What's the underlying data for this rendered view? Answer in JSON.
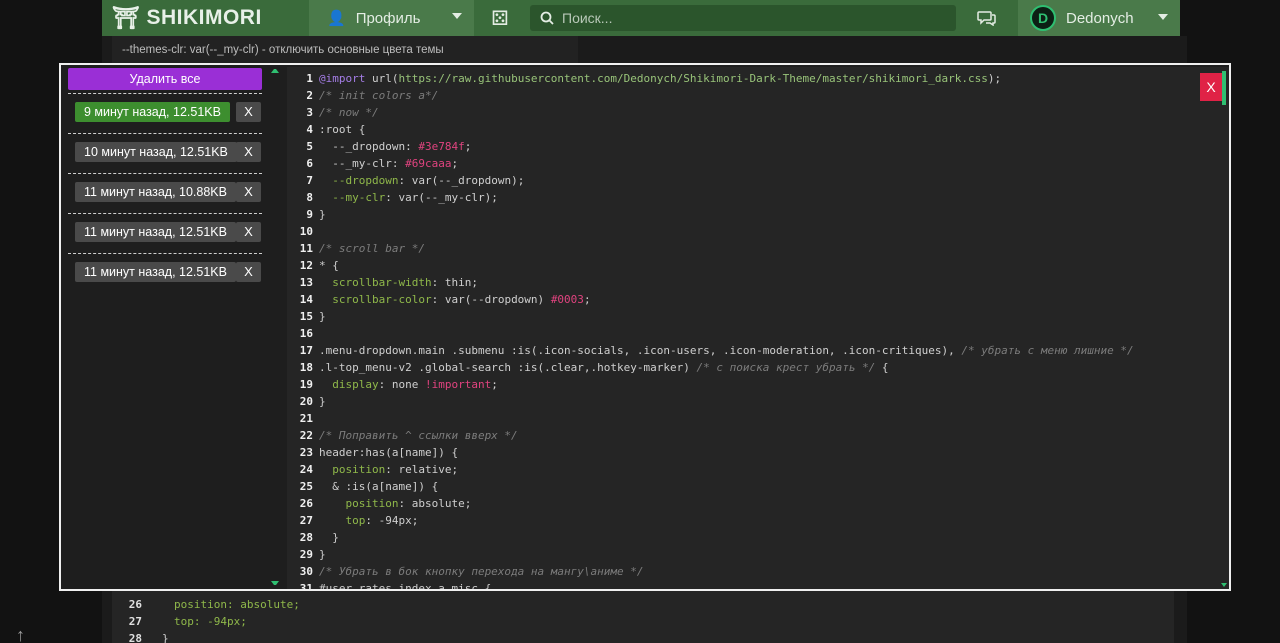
{
  "nav": {
    "logo_text": "SHIKIMORI",
    "profile_label": "Профиль",
    "search_placeholder": "Поиск...",
    "username": "Dedonych",
    "avatar_letter": "D"
  },
  "background": {
    "notes": [
      "--themes-clr: var(--_my-clr) - отключить основные цвета темы"
    ],
    "code_lines": [
      {
        "n": "26",
        "t": "position: absolute;"
      },
      {
        "n": "27",
        "t": "top: -94px;"
      },
      {
        "n": "28",
        "t": "}"
      }
    ]
  },
  "history": {
    "delete_all_label": "Удалить все",
    "remove_label": "X",
    "entries": [
      {
        "label": "9 минут назад, 12.51KB",
        "active": true
      },
      {
        "label": "10 минут назад, 12.51KB",
        "active": false
      },
      {
        "label": "11 минут назад, 10.88KB",
        "active": false
      },
      {
        "label": "11 минут назад, 12.51KB",
        "active": false
      },
      {
        "label": "11 минут назад, 12.51KB",
        "active": false
      }
    ]
  },
  "editor": {
    "close_label": "X",
    "lines": [
      {
        "n": "1",
        "t": "@import url(https://raw.githubusercontent.com/Dedonych/Shikimori-Dark-Theme/master/shikimori_dark.css);"
      },
      {
        "n": "2",
        "t": "/* init colors a*/"
      },
      {
        "n": "3",
        "t": "/* now */"
      },
      {
        "n": "4",
        "t": ":root {"
      },
      {
        "n": "5",
        "t": "  --_dropdown: #3e784f;"
      },
      {
        "n": "6",
        "t": "  --_my-clr: #69caaa;"
      },
      {
        "n": "7",
        "t": "  --dropdown: var(--_dropdown);"
      },
      {
        "n": "8",
        "t": "  --my-clr: var(--_my-clr);"
      },
      {
        "n": "9",
        "t": "}"
      },
      {
        "n": "10",
        "t": ""
      },
      {
        "n": "11",
        "t": "/* scroll bar */"
      },
      {
        "n": "12",
        "t": "* {"
      },
      {
        "n": "13",
        "t": "  scrollbar-width: thin;"
      },
      {
        "n": "14",
        "t": "  scrollbar-color: var(--dropdown) #0003;"
      },
      {
        "n": "15",
        "t": "}"
      },
      {
        "n": "16",
        "t": ""
      },
      {
        "n": "17",
        "t": ".menu-dropdown.main .submenu :is(.icon-socials, .icon-users, .icon-moderation, .icon-critiques), /* убрать с меню лишние */"
      },
      {
        "n": "18",
        "t": ".l-top_menu-v2 .global-search :is(.clear,.hotkey-marker) /* с поиска крест убрать */ {"
      },
      {
        "n": "19",
        "t": "  display: none !important;"
      },
      {
        "n": "20",
        "t": "}"
      },
      {
        "n": "21",
        "t": ""
      },
      {
        "n": "22",
        "t": "/* Поправить ^ ссылки вверх */"
      },
      {
        "n": "23",
        "t": "header:has(a[name]) {"
      },
      {
        "n": "24",
        "t": "  position: relative;"
      },
      {
        "n": "25",
        "t": "  & :is(a[name]) {"
      },
      {
        "n": "26",
        "t": "    position: absolute;"
      },
      {
        "n": "27",
        "t": "    top: -94px;"
      },
      {
        "n": "28",
        "t": "  }"
      },
      {
        "n": "29",
        "t": "}"
      },
      {
        "n": "30",
        "t": "/* Убрать в бок кнопку перехода на мангу\\аниме */"
      },
      {
        "n": "31",
        "t": "#user_rates_index a.misc {"
      }
    ]
  }
}
